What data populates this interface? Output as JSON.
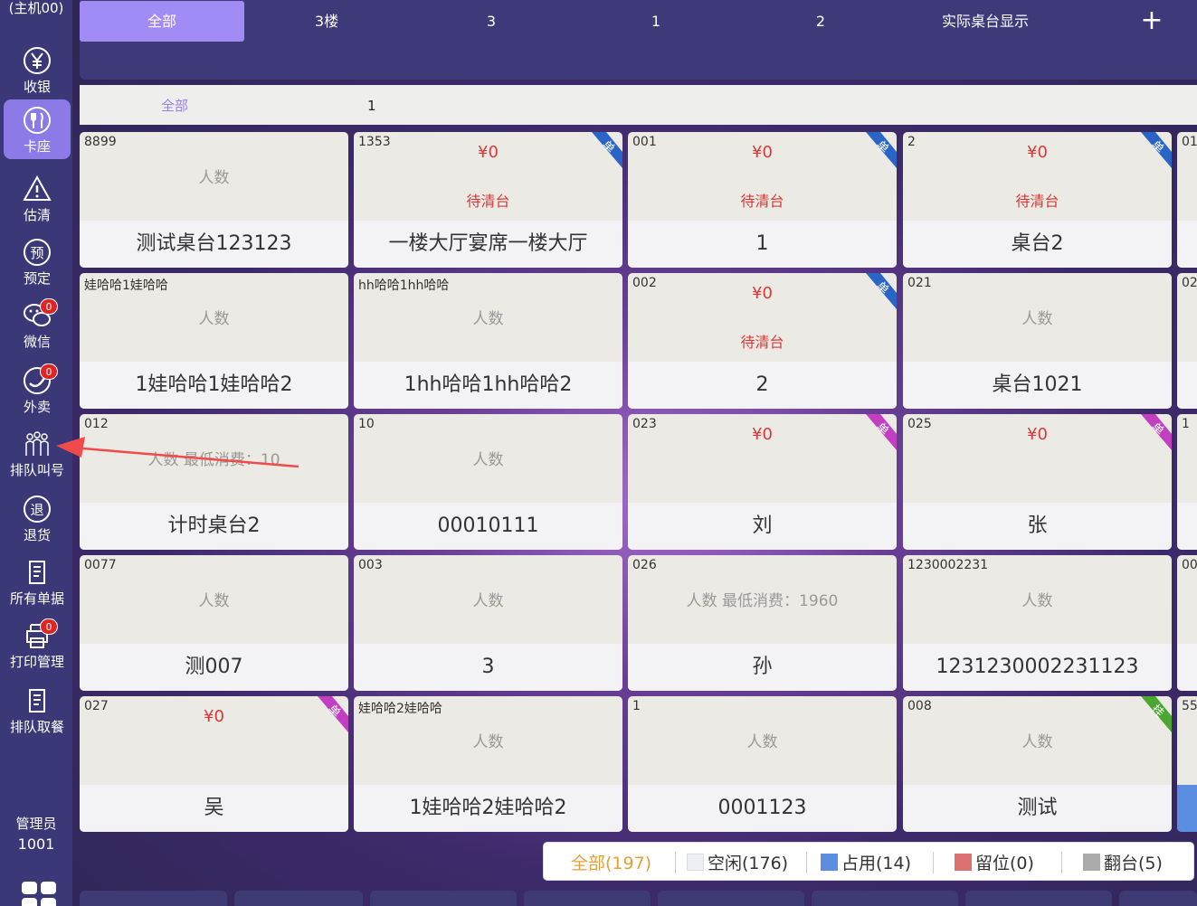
{
  "sidebar": {
    "host": "(主机00)",
    "items": [
      {
        "label": "收银",
        "icon": "yen-icon",
        "active": false,
        "badge": ""
      },
      {
        "label": "卡座",
        "icon": "fork-knife-icon",
        "active": true,
        "badge": ""
      },
      {
        "label": "估清",
        "icon": "warning-icon",
        "active": false,
        "badge": ""
      },
      {
        "label": "预定",
        "icon": "reserve-icon",
        "active": false,
        "badge": ""
      },
      {
        "label": "微信",
        "icon": "wechat-icon",
        "active": false,
        "badge": "0"
      },
      {
        "label": "外卖",
        "icon": "takeout-icon",
        "active": false,
        "badge": "0"
      },
      {
        "label": "排队叫号",
        "icon": "queue-people-icon",
        "active": false,
        "badge": ""
      },
      {
        "label": "退货",
        "icon": "return-icon",
        "active": false,
        "badge": ""
      },
      {
        "label": "所有单据",
        "icon": "documents-icon",
        "active": false,
        "badge": ""
      },
      {
        "label": "打印管理",
        "icon": "printer-icon",
        "active": false,
        "badge": "0"
      },
      {
        "label": "排队取餐",
        "icon": "pickup-icon",
        "active": false,
        "badge": ""
      }
    ],
    "admin_role": "管理员",
    "admin_id": "1001"
  },
  "floor_tabs": [
    "全部",
    "3楼",
    "3",
    "1",
    "2",
    "实际桌台显示"
  ],
  "floor_add": "+",
  "area_tabs": [
    "全部",
    "1"
  ],
  "cards": [
    {
      "code": "8899",
      "people": "人数",
      "price": "",
      "status": "",
      "name": "测试桌台123123",
      "ribbon": "",
      "ribbon_color": ""
    },
    {
      "code": "1353",
      "people": "",
      "price": "¥0",
      "status": "待清台",
      "name": "一楼大厅宴席一楼大厅",
      "ribbon": "单",
      "ribbon_color": "#2a64c7"
    },
    {
      "code": "001",
      "people": "",
      "price": "¥0",
      "status": "待清台",
      "name": "1",
      "ribbon": "单",
      "ribbon_color": "#2a64c7"
    },
    {
      "code": "2",
      "people": "",
      "price": "¥0",
      "status": "待清台",
      "name": "桌台2",
      "ribbon": "单",
      "ribbon_color": "#2a64c7"
    },
    {
      "code": "娃哈哈1娃哈哈",
      "people": "人数",
      "price": "",
      "status": "",
      "name": "1娃哈哈1娃哈哈2",
      "ribbon": "",
      "ribbon_color": ""
    },
    {
      "code": "hh哈哈1hh哈哈",
      "people": "人数",
      "price": "",
      "status": "",
      "name": "1hh哈哈1hh哈哈2",
      "ribbon": "",
      "ribbon_color": ""
    },
    {
      "code": "002",
      "people": "",
      "price": "¥0",
      "status": "待清台",
      "name": "2",
      "ribbon": "单",
      "ribbon_color": "#2a64c7"
    },
    {
      "code": "021",
      "people": "人数",
      "price": "",
      "status": "",
      "name": "桌台1021",
      "ribbon": "",
      "ribbon_color": ""
    },
    {
      "code": "012",
      "people": "人数 最低消费：10",
      "price": "",
      "status": "",
      "name": "计时桌台2",
      "ribbon": "",
      "ribbon_color": ""
    },
    {
      "code": "10",
      "people": "人数",
      "price": "",
      "status": "",
      "name": "00010111",
      "ribbon": "",
      "ribbon_color": ""
    },
    {
      "code": "023",
      "people": "",
      "price": "¥0",
      "status": "",
      "name": "刘",
      "ribbon": "单",
      "ribbon_color": "#c23fc2"
    },
    {
      "code": "025",
      "people": "",
      "price": "¥0",
      "status": "",
      "name": "张",
      "ribbon": "单",
      "ribbon_color": "#c23fc2"
    },
    {
      "code": "0077",
      "people": "人数",
      "price": "",
      "status": "",
      "name": "测007",
      "ribbon": "",
      "ribbon_color": ""
    },
    {
      "code": "003",
      "people": "人数",
      "price": "",
      "status": "",
      "name": "3",
      "ribbon": "",
      "ribbon_color": ""
    },
    {
      "code": "026",
      "people": "人数 最低消费：1960",
      "price": "",
      "status": "",
      "name": "孙",
      "ribbon": "",
      "ribbon_color": ""
    },
    {
      "code": "1230002231",
      "people": "人数",
      "price": "",
      "status": "",
      "name": "1231230002231123",
      "ribbon": "",
      "ribbon_color": ""
    },
    {
      "code": "027",
      "people": "",
      "price": "¥0",
      "status": "",
      "name": "吴",
      "ribbon": "单",
      "ribbon_color": "#c23fc2"
    },
    {
      "code": "娃哈哈2娃哈哈",
      "people": "人数",
      "price": "",
      "status": "",
      "name": "1娃哈哈2娃哈哈2",
      "ribbon": "",
      "ribbon_color": ""
    },
    {
      "code": "1",
      "people": "人数",
      "price": "",
      "status": "",
      "name": "0001123",
      "ribbon": "",
      "ribbon_color": ""
    },
    {
      "code": "008",
      "people": "人数",
      "price": "",
      "status": "",
      "name": "测试",
      "ribbon": "挂",
      "ribbon_color": "#4aa832"
    }
  ],
  "partial_cards": [
    "01",
    "02",
    "1",
    "00",
    "55"
  ],
  "legend": {
    "all": "全部(197)",
    "free": "空闲(176)",
    "occupied": "占用(14)",
    "reserved": "留位(0)",
    "turned": "翻台(5)",
    "free_color": "#eef0f6",
    "occupied_color": "#5b8ee0",
    "reserved_color": "#dc7170",
    "turned_color": "#aaaaaa"
  },
  "colors": {
    "sidebar_bg": "#3a3877",
    "accent": "#a18cf5",
    "price_red": "#d93838"
  }
}
